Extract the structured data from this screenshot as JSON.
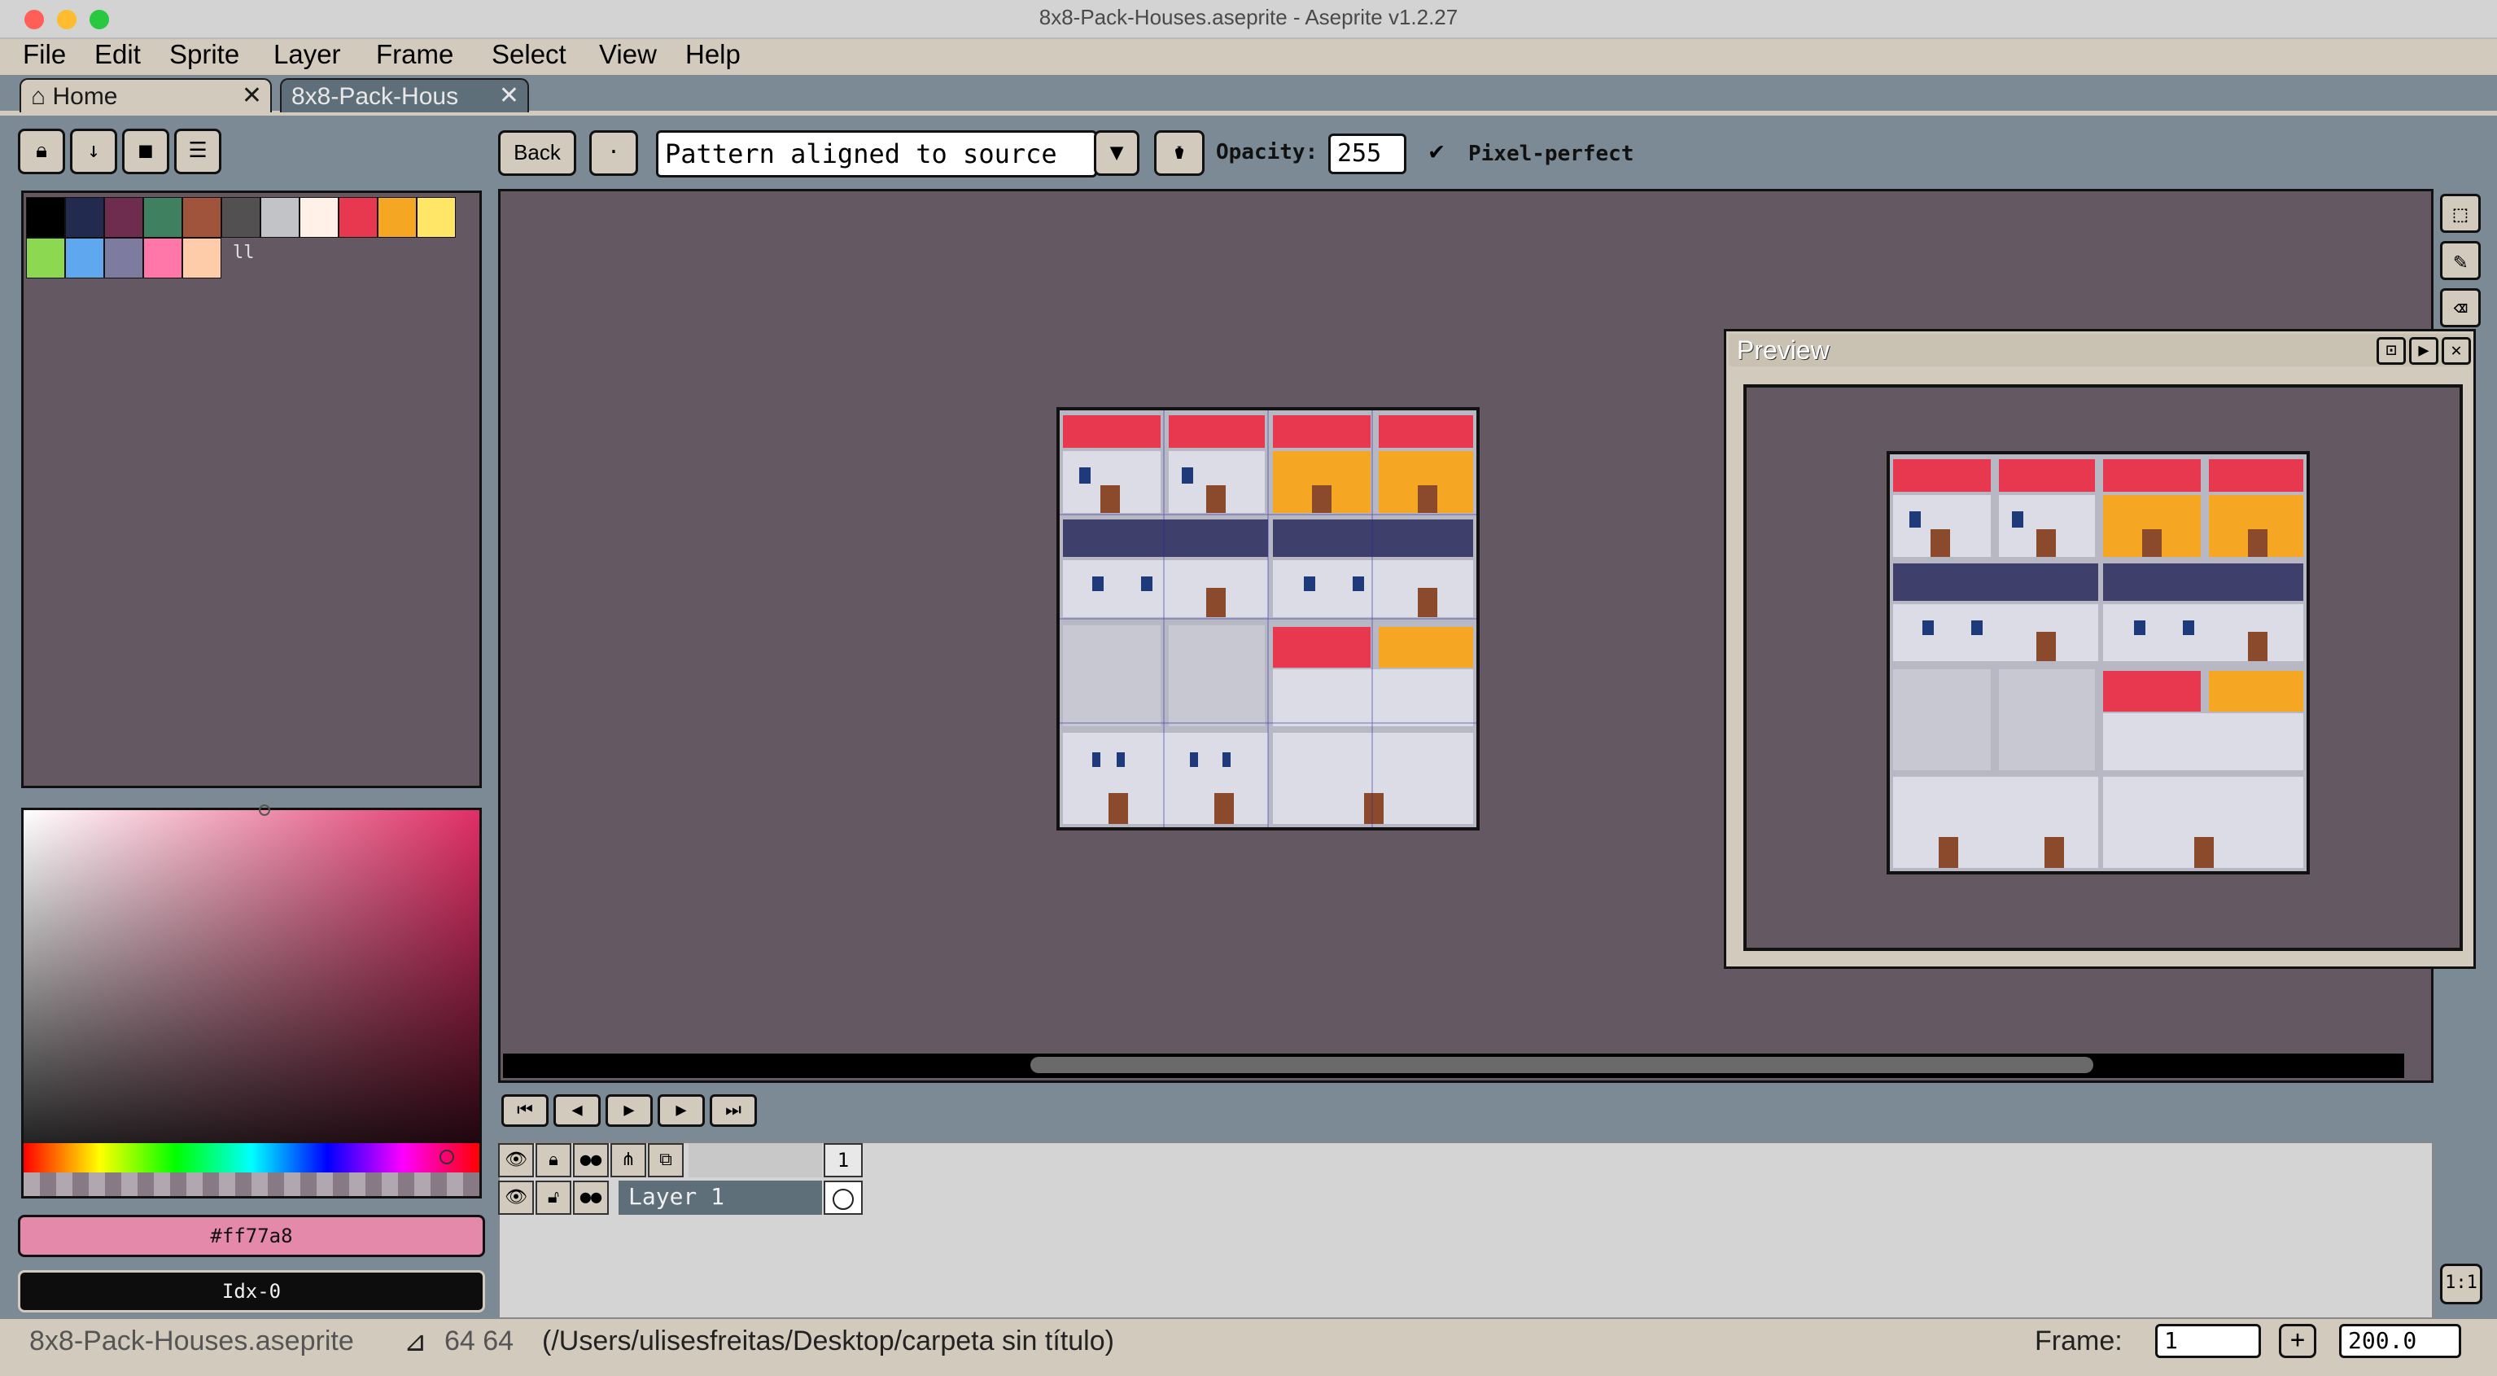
{
  "window": {
    "title": "8x8-Pack-Houses.aseprite - Aseprite v1.2.27"
  },
  "menu": [
    "File",
    "Edit",
    "Sprite",
    "Layer",
    "Frame",
    "Select",
    "View",
    "Help"
  ],
  "tabs": {
    "home": "Home",
    "file": "8x8-Pack-Hous",
    "close": "✕"
  },
  "toolbar": {
    "back": "Back",
    "pattern": "Pattern aligned to source",
    "opacity_label": "Opacity:",
    "opacity_value": "255",
    "pixel_perfect": "Pixel-perfect",
    "check": "✔"
  },
  "palette": {
    "colors": [
      "#000000",
      "#222a4f",
      "#6e2c4f",
      "#3f8061",
      "#a0543c",
      "#525050",
      "#c2c3c7",
      "#fff1e8",
      "#e8384f",
      "#f5a623",
      "#ffe666",
      "#8cd850",
      "#5fa8f0",
      "#7e7ba0",
      "#ff77a8",
      "#ffccaa"
    ],
    "selected": "#ff77a8",
    "more": "ll"
  },
  "color_fields": {
    "hex": "#ff77a8",
    "index": "Idx-0"
  },
  "preview": {
    "title": "Preview"
  },
  "timeline": {
    "frame_number": "1",
    "layer": "Layer 1"
  },
  "statusbar": {
    "filename": "8x8-Pack-Houses.aseprite",
    "size": "64 64",
    "path": "(/Users/ulisesfreitas/Desktop/carpeta sin título)",
    "frame_label": "Frame:",
    "frame_value": "1",
    "zoom": "200.0",
    "plus": "+",
    "one_to_one": "1:1"
  },
  "colors": {
    "chrome": "#d2cbbd",
    "canvas_bg": "#645863",
    "desktop": "#7b8a95"
  }
}
